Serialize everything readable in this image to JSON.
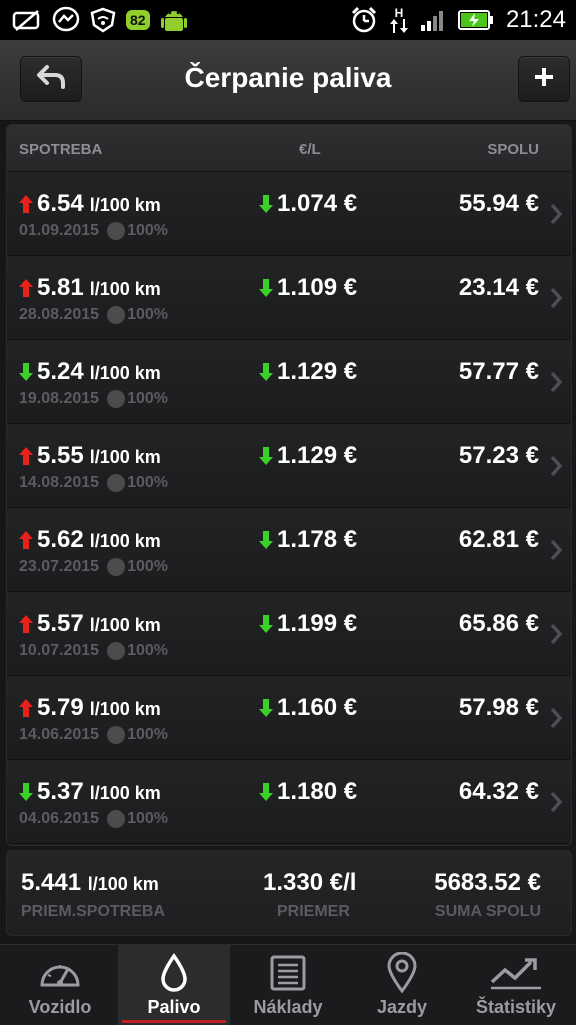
{
  "status_bar": {
    "battery_badge": "82",
    "network_letter": "H",
    "time": "21:24"
  },
  "header": {
    "title": "Čerpanie paliva"
  },
  "columns": {
    "consumption": "SPOTREBA",
    "price": "€/L",
    "total": "SPOLU"
  },
  "colors": {
    "up_arrow": "#e8221b",
    "down_arrow": "#3bd12b",
    "accent_red": "#c02020"
  },
  "rows": [
    {
      "trend": "up",
      "value": "6.54",
      "unit": "l/100 km",
      "date": "01.09.2015",
      "fill": "100%",
      "price_trend": "down",
      "price": "1.074 €",
      "total": "55.94 €"
    },
    {
      "trend": "up",
      "value": "5.81",
      "unit": "l/100 km",
      "date": "28.08.2015",
      "fill": "100%",
      "price_trend": "down",
      "price": "1.109 €",
      "total": "23.14 €"
    },
    {
      "trend": "down",
      "value": "5.24",
      "unit": "l/100 km",
      "date": "19.08.2015",
      "fill": "100%",
      "price_trend": "down",
      "price": "1.129 €",
      "total": "57.77 €"
    },
    {
      "trend": "up",
      "value": "5.55",
      "unit": "l/100 km",
      "date": "14.08.2015",
      "fill": "100%",
      "price_trend": "down",
      "price": "1.129 €",
      "total": "57.23 €"
    },
    {
      "trend": "up",
      "value": "5.62",
      "unit": "l/100 km",
      "date": "23.07.2015",
      "fill": "100%",
      "price_trend": "down",
      "price": "1.178 €",
      "total": "62.81 €"
    },
    {
      "trend": "up",
      "value": "5.57",
      "unit": "l/100 km",
      "date": "10.07.2015",
      "fill": "100%",
      "price_trend": "down",
      "price": "1.199 €",
      "total": "65.86 €"
    },
    {
      "trend": "up",
      "value": "5.79",
      "unit": "l/100 km",
      "date": "14.06.2015",
      "fill": "100%",
      "price_trend": "down",
      "price": "1.160 €",
      "total": "57.98 €"
    },
    {
      "trend": "down",
      "value": "5.37",
      "unit": "l/100 km",
      "date": "04.06.2015",
      "fill": "100%",
      "price_trend": "down",
      "price": "1.180 €",
      "total": "64.32 €"
    }
  ],
  "summary": {
    "consumption_value": "5.441",
    "consumption_unit": "l/100 km",
    "consumption_label": "PRIEM.SPOTREBA",
    "price_value": "1.330 €/l",
    "price_label": "PRIEMER",
    "total_value": "5683.52 €",
    "total_label": "SUMA SPOLU"
  },
  "nav": [
    {
      "label": "Vozidlo",
      "icon": "gauge-icon",
      "active": false
    },
    {
      "label": "Palivo",
      "icon": "drop-icon",
      "active": true
    },
    {
      "label": "Náklady",
      "icon": "document-icon",
      "active": false
    },
    {
      "label": "Jazdy",
      "icon": "map-pin-icon",
      "active": false
    },
    {
      "label": "Štatistiky",
      "icon": "chart-icon",
      "active": false
    }
  ]
}
